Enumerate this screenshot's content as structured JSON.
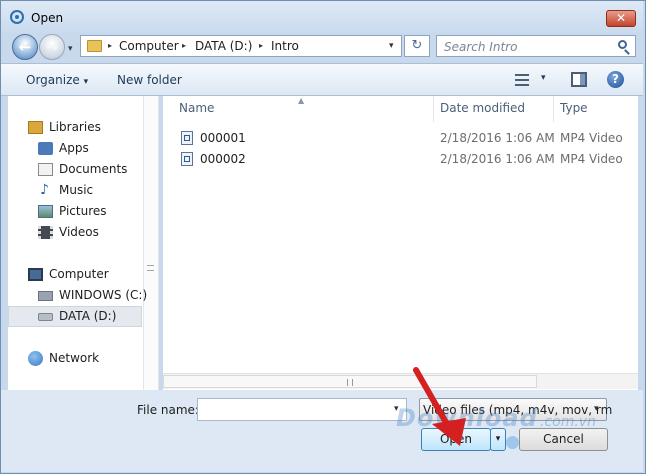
{
  "window": {
    "title": "Open"
  },
  "title_bar": {
    "close_glyph": "✕"
  },
  "nav_buttons": {
    "back_glyph": "←",
    "forward_glyph": "→",
    "history_glyph": "▾"
  },
  "address": {
    "crumbs": [
      "Computer",
      "DATA (D:)",
      "Intro"
    ],
    "separator": "▸",
    "dropdown_glyph": "▾",
    "refresh_glyph": "↻"
  },
  "search": {
    "placeholder": "Search Intro"
  },
  "toolbar": {
    "organize_label": "Organize",
    "organize_arrow": "▾",
    "new_folder_label": "New folder",
    "view_arrow": "▾",
    "help_glyph": "?"
  },
  "nav_pane": {
    "items": [
      {
        "label": "Libraries",
        "icon": "library-icon",
        "color": "#d9a73a"
      },
      {
        "label": "Apps",
        "icon": "apps-icon",
        "color": "#4a7ab8"
      },
      {
        "label": "Documents",
        "icon": "documents-icon",
        "color": "#f2f2f2"
      },
      {
        "label": "Music",
        "icon": "music-icon",
        "color": "#2b64b4"
      },
      {
        "label": "Pictures",
        "icon": "pictures-icon",
        "color": "#6d8fb0"
      },
      {
        "label": "Videos",
        "icon": "videos-icon",
        "color": "#444a52"
      },
      {
        "label": "Computer",
        "icon": "computer-icon",
        "color": "#4a6a96"
      },
      {
        "label": "WINDOWS (C:)",
        "icon": "drive-icon",
        "color": "#9aa3ad"
      },
      {
        "label": "DATA (D:)",
        "icon": "drive-icon",
        "color": "#b8bec6",
        "selected": true
      },
      {
        "label": "Network",
        "icon": "network-icon",
        "color": "#3b78c2"
      }
    ]
  },
  "file_list": {
    "sort_glyph": "▲",
    "columns": [
      "Name",
      "Date modified",
      "Type"
    ],
    "rows": [
      {
        "name": "000001",
        "date": "2/18/2016 1:06 AM",
        "type": "MP4 Video"
      },
      {
        "name": "000002",
        "date": "2/18/2016 1:06 AM",
        "type": "MP4 Video"
      }
    ]
  },
  "bottom": {
    "file_name_label": "File name:",
    "file_name_value": "",
    "dropdown_glyph": "▾",
    "file_type_value": "Video files (mp4, m4v, mov, rm",
    "open_label": "Open",
    "cancel_label": "Cancel"
  },
  "watermark": {
    "text": "Download",
    "suffix": ".com.vn"
  },
  "colors": {
    "annotation_arrow": "#d42020",
    "accent": "#3c7fb1"
  }
}
